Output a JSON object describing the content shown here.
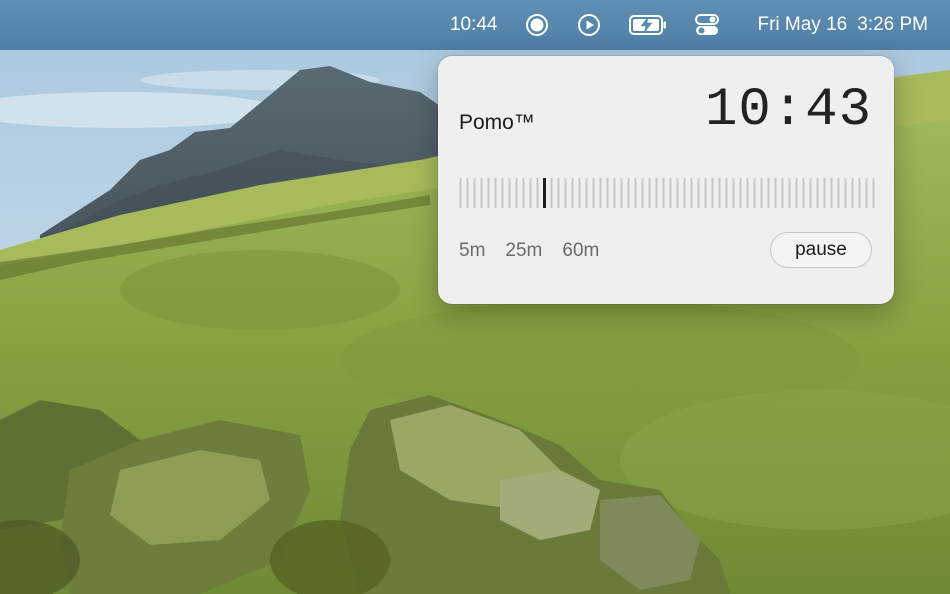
{
  "menubar": {
    "timer_text": "10:44",
    "status_icons": [
      "record-circle-icon",
      "play-circle-icon",
      "battery-charging-icon",
      "control-center-icon"
    ],
    "date": "Fri May 16",
    "clock": "3:26 PM"
  },
  "popover": {
    "title": "Pomo™",
    "timer": "10:43",
    "ruler_position": 0.2,
    "presets": [
      "5m",
      "25m",
      "60m"
    ],
    "pause_label": "pause"
  },
  "colors": {
    "menubar": "#5a8ab0",
    "popover_bg": "#efefef",
    "grass": "#8aa64a",
    "sky": "#bcd5e6"
  }
}
